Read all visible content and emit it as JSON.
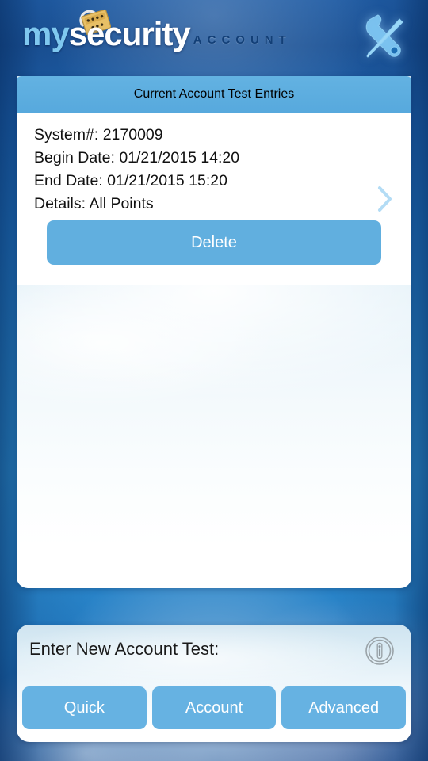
{
  "brand": {
    "logo_primary": "my",
    "logo_secondary": "security",
    "logo_subtitle": "ACCOUNT",
    "padlock_icon": "padlock-icon",
    "tools_icon": "tools-icon",
    "accent_color": "#61afdf",
    "header_color": "#5aabdd",
    "logo_my_color": "#7fc8ef",
    "logo_security_color": "#ffffff",
    "subtitle_color": "#123f77"
  },
  "panel": {
    "header_title": "Current Account Test Entries",
    "entry": {
      "lines": [
        "System#: 2170009",
        "Begin Date: 01/21/2015 14:20",
        "End Date: 01/21/2015 15:20",
        "Details: All Points"
      ],
      "system_number": "2170009",
      "begin_date": "01/21/2015 14:20",
      "end_date": "01/21/2015 15:20",
      "details": "All Points",
      "chevron_icon": "chevron-right-icon",
      "delete_label": "Delete"
    }
  },
  "bottom": {
    "title": "Enter New Account Test:",
    "info_icon": "info-icon",
    "modes": [
      {
        "label": "Quick"
      },
      {
        "label": "Account"
      },
      {
        "label": "Advanced"
      }
    ]
  }
}
